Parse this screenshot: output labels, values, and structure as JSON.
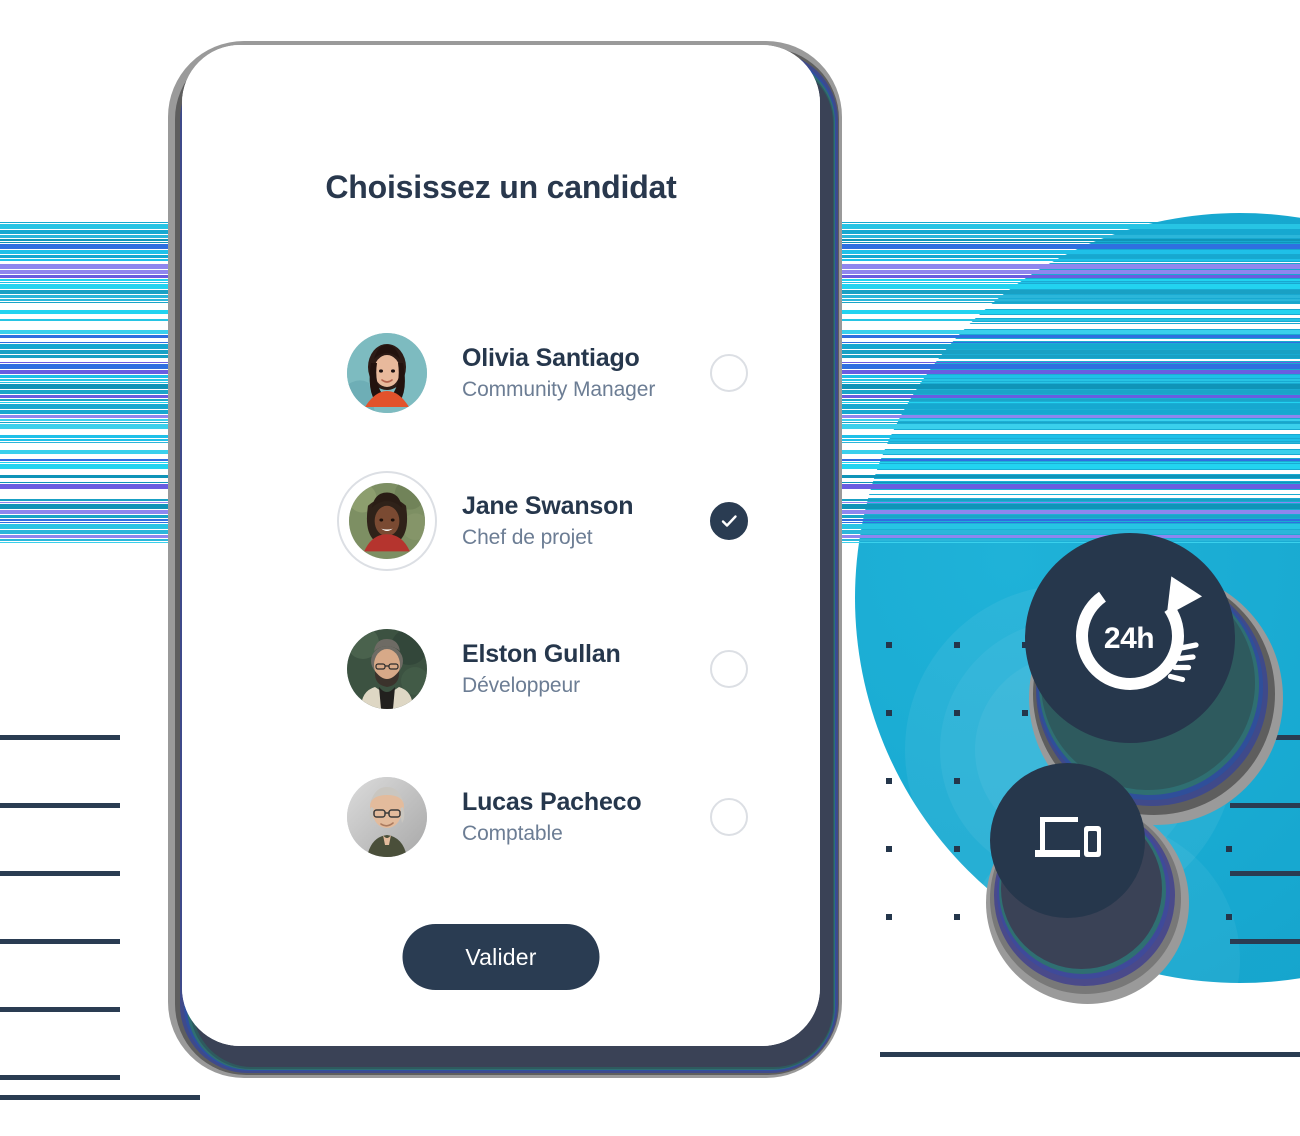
{
  "screen": {
    "title": "Choisissez un candidat",
    "validate_label": "Valider"
  },
  "candidates": [
    {
      "name": "Olivia Santiago",
      "role": "Community Manager",
      "selected": false,
      "avatar_alt": "photo-olivia-santiago"
    },
    {
      "name": "Jane Swanson",
      "role": "Chef de projet",
      "selected": true,
      "avatar_alt": "photo-jane-swanson"
    },
    {
      "name": "Elston Gullan",
      "role": "Développeur",
      "selected": false,
      "avatar_alt": "photo-elston-gullan"
    },
    {
      "name": "Lucas Pacheco",
      "role": "Comptable",
      "selected": false,
      "avatar_alt": "photo-lucas-pacheco"
    }
  ],
  "badges": {
    "turnaround": {
      "label": "24h",
      "icon": "refresh-clock-icon"
    },
    "devices": {
      "icon": "laptop-phone-icon"
    }
  },
  "colors": {
    "navy": "#26374c",
    "navy_button": "#2a3c52",
    "cyan": "#17a8d0",
    "role_text": "#6c7d94",
    "radio_border": "#dcdfe4",
    "white": "#ffffff"
  }
}
